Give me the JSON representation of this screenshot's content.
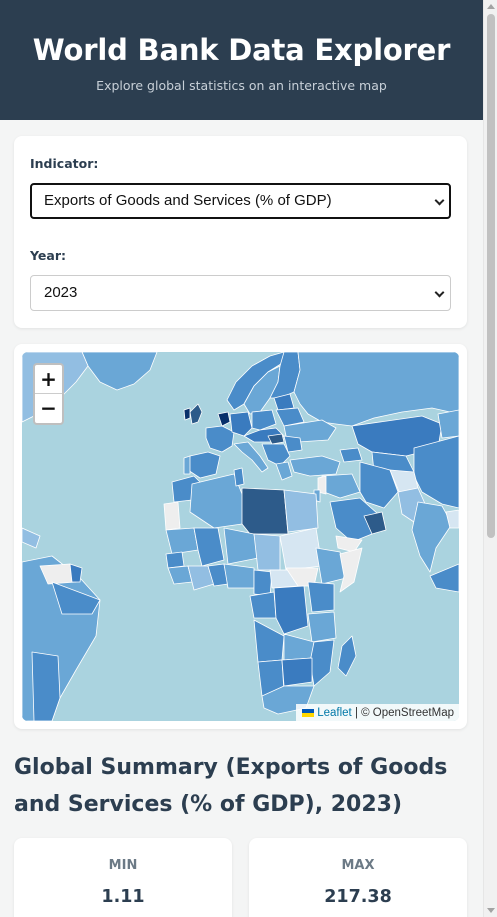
{
  "header": {
    "title": "World Bank Data Explorer",
    "subtitle": "Explore global statistics on an interactive map"
  },
  "controls": {
    "indicator_label": "Indicator:",
    "indicator_value": "Exports of Goods and Services (% of GDP)",
    "year_label": "Year:",
    "year_value": "2023"
  },
  "map": {
    "zoom_in": "+",
    "zoom_out": "−",
    "attribution_link": "Leaflet",
    "attribution_text": "| © OpenStreetMap",
    "ocean_color": "#aad3df",
    "choropleth_colors": [
      "#08306b",
      "#2d5b8a",
      "#3a7bbf",
      "#4a8cc9",
      "#6aa7d6",
      "#92bee2",
      "#bcd7ec",
      "#d6e6f2",
      "#eeeeee"
    ]
  },
  "summary": {
    "title": "Global Summary (Exports of Goods and Services (% of GDP), 2023)",
    "min_label": "MIN",
    "min_value": "1.11",
    "max_label": "MAX",
    "max_value": "217.38"
  },
  "icons": {
    "flag": "ukraine-flag-icon",
    "select_arrow": "chevron-down-icon"
  }
}
